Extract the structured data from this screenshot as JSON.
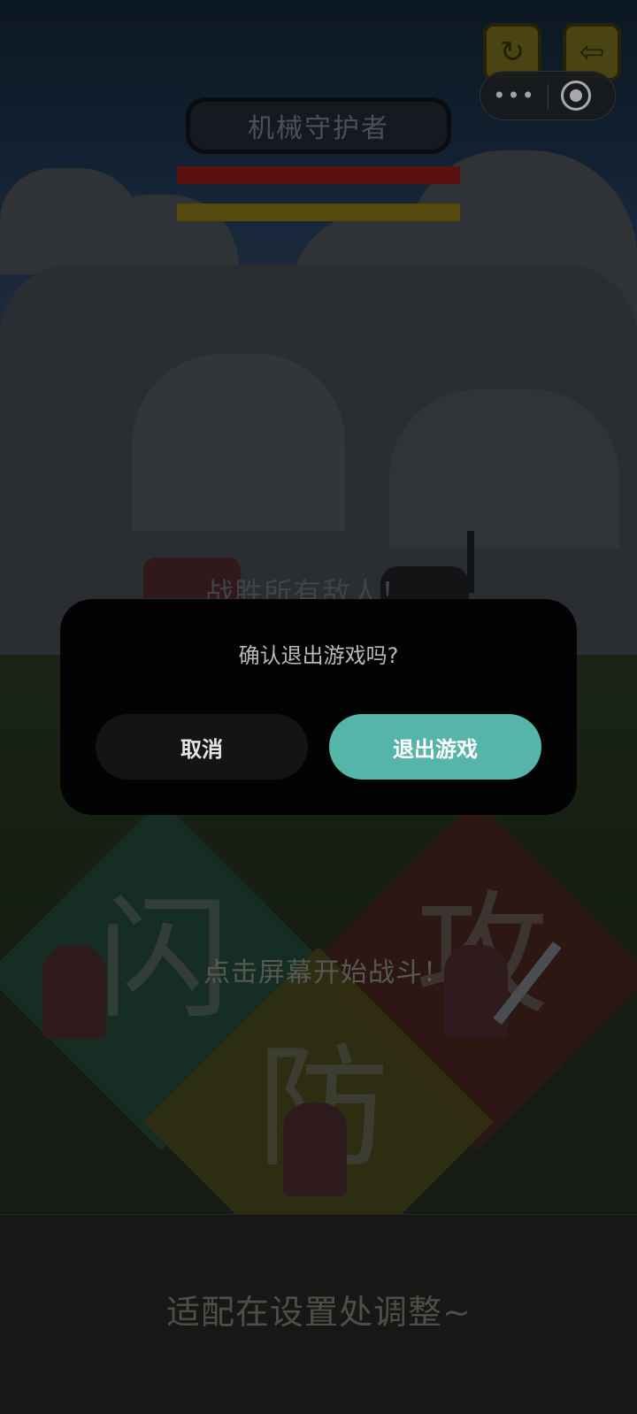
{
  "header": {
    "boss_name": "机械守护者"
  },
  "top_buttons": {
    "restart_icon": "refresh-icon",
    "exit_icon": "exit-icon"
  },
  "capsule": {
    "more_label": "•••",
    "more_icon": "more-icon",
    "close_icon": "target-icon"
  },
  "battle": {
    "goal_text": "战胜所有敌人！",
    "tap_to_start": "点击屏幕开始战斗！",
    "dodge_char": "闪",
    "attack_char": "攻",
    "defend_char": "防",
    "bottom_hint": "适配在设置处调整~"
  },
  "dialog": {
    "title": "确认退出游戏吗?",
    "cancel_label": "取消",
    "exit_label": "退出游戏"
  },
  "colors": {
    "accent": "#56b5a8",
    "hp": "#6f1414",
    "energy": "#6a5a12",
    "dodge": "#1c4a3a",
    "attack": "#4a1e16",
    "defend": "#4a4616"
  }
}
